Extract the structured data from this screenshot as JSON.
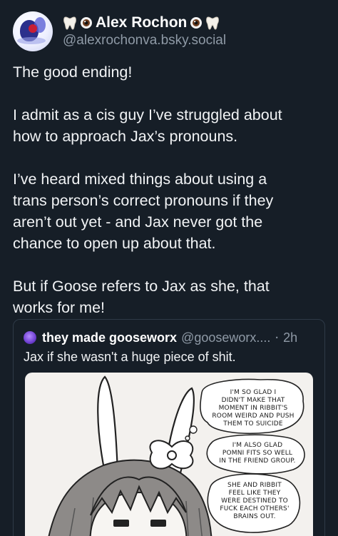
{
  "author": {
    "display_name": "Alex Rochon",
    "handle": "@alexrochonva.bsky.social",
    "name_emojis": [
      "tooth-icon",
      "eye-icon"
    ]
  },
  "post": {
    "paragraphs": [
      [
        "The good ending!"
      ],
      [
        "I admit as a cis guy I’ve struggled about",
        "how to approach Jax’s pronouns."
      ],
      [
        "I’ve heard mixed things about using a",
        "trans person’s correct pronouns if they",
        "aren’t out yet - and Jax never got the",
        "chance to open up about that."
      ],
      [
        "But if Goose refers to Jax as she, that",
        "works for me!"
      ]
    ]
  },
  "quoted_post": {
    "display_name": "they made gooseworx",
    "handle": "@gooseworx....",
    "separator": "·",
    "time": "2h",
    "text": "Jax if she wasn't a huge piece of shit.",
    "image_bubbles": [
      [
        "I'M SO GLAD I",
        "DIDN'T MAKE THAT",
        "MOMENT IN RIBBIT'S",
        "ROOM WEIRD AND PUSH",
        "THEM TO SUICIDE"
      ],
      [
        "I'M ALSO GLAD",
        "POMNI FITS SO WELL",
        "IN THE FRIEND GROUP."
      ],
      [
        "SHE AND RIBBIT",
        "FEEL LIKE THEY",
        "WERE DESTINED TO",
        "FUCK EACH OTHERS'",
        "BRAINS OUT."
      ]
    ]
  }
}
